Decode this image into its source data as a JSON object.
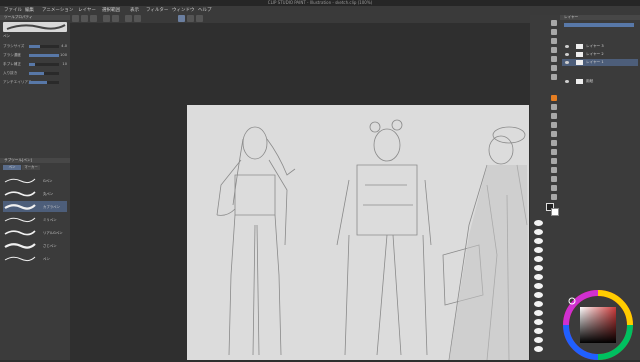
{
  "window": {
    "title": "CLIP STUDIO PAINT - Illustration - sketch.clip (100%)"
  },
  "menu": [
    "ファイル",
    "編集",
    "アニメーション",
    "レイヤー",
    "選択範囲",
    "表示",
    "フィルター",
    "ウィンドウ",
    "ヘルプ"
  ],
  "tool_property": {
    "title": "ツールプロパティ",
    "brush_name": "ペン",
    "rows": [
      {
        "label": "ブラシサイズ",
        "value": "4.0",
        "level": 0.35
      },
      {
        "label": "ブラシ濃度",
        "value": "100",
        "level": 1.0
      },
      {
        "label": "手ブレ補正",
        "value": "10",
        "level": 0.2
      },
      {
        "label": "入り抜き",
        "value": "",
        "level": 0.5
      },
      {
        "label": "アンチエイリアス",
        "value": "",
        "level": 0.6
      }
    ]
  },
  "sub_tool": {
    "title": "サブツール[ペン]",
    "tabs": [
      "ペン",
      "マーカー"
    ],
    "brushes": [
      "Gペン",
      "丸ペン",
      "カブラペン",
      "ミリペン",
      "リアルGペン",
      "さじペン",
      "ペン"
    ],
    "selected_index": 2
  },
  "layers": {
    "title": "レイヤー",
    "items": [
      "レイヤー 3",
      "レイヤー 2",
      "レイヤー 1",
      "用紙"
    ],
    "selected_index": 2
  },
  "colors": {
    "accent": "#e67e22",
    "selection": "#4d5e7a",
    "main_color": "#cc3b3b"
  }
}
